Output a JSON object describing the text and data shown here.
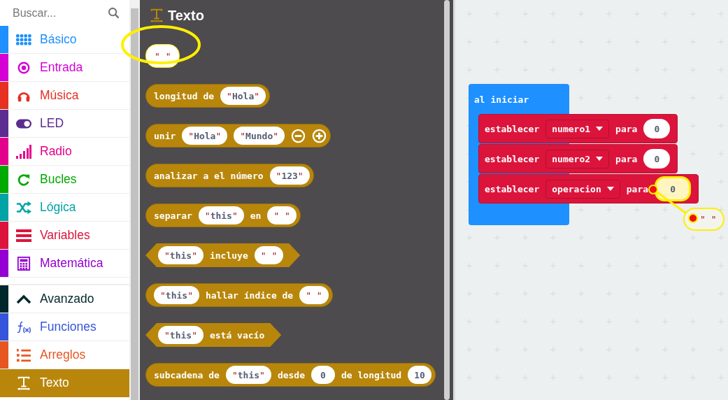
{
  "search": {
    "placeholder": "Buscar..."
  },
  "categories": [
    {
      "label": "Básico",
      "color": "#1e90ff",
      "selected": false
    },
    {
      "label": "Entrada",
      "color": "#d400d4",
      "selected": false
    },
    {
      "label": "Música",
      "color": "#e63022",
      "selected": false
    },
    {
      "label": "LED",
      "color": "#5c2d91",
      "selected": false
    },
    {
      "label": "Radio",
      "color": "#e3008c",
      "selected": false
    },
    {
      "label": "Bucles",
      "color": "#00aa00",
      "selected": false
    },
    {
      "label": "Lógica",
      "color": "#00a4a6",
      "selected": false
    },
    {
      "label": "Variables",
      "color": "#dc143c",
      "selected": false
    },
    {
      "label": "Matemática",
      "color": "#9400d3",
      "selected": false
    }
  ],
  "advanced_categories": [
    {
      "label": "Avanzado",
      "color": "#00272b",
      "selected": false
    },
    {
      "label": "Funciones",
      "color": "#3455db",
      "selected": false
    },
    {
      "label": "Arreglos",
      "color": "#e65722",
      "selected": false
    },
    {
      "label": "Texto",
      "color": "#b8860b",
      "selected": true
    }
  ],
  "flyout": {
    "title": "Texto",
    "blocks": [
      {
        "kind": "bare",
        "highlighted": true,
        "parts": [
          {
            "kind": "string",
            "value": "\" \""
          }
        ]
      },
      {
        "kind": "round",
        "highlighted": false,
        "parts": [
          {
            "kind": "label",
            "text": "longitud de"
          },
          {
            "kind": "string",
            "value": "\"Hola\""
          }
        ]
      },
      {
        "kind": "round",
        "highlighted": false,
        "parts": [
          {
            "kind": "label",
            "text": "unir"
          },
          {
            "kind": "string",
            "value": "\"Hola\""
          },
          {
            "kind": "string",
            "value": "\"Mundo\""
          },
          {
            "kind": "remove"
          },
          {
            "kind": "add"
          }
        ]
      },
      {
        "kind": "round",
        "highlighted": false,
        "parts": [
          {
            "kind": "label",
            "text": "analizar a el número"
          },
          {
            "kind": "string",
            "value": "\"123\""
          }
        ]
      },
      {
        "kind": "round",
        "highlighted": false,
        "parts": [
          {
            "kind": "label",
            "text": "separar"
          },
          {
            "kind": "string",
            "value": "\"this\""
          },
          {
            "kind": "label",
            "text": "en"
          },
          {
            "kind": "string",
            "value": "\" \""
          }
        ]
      },
      {
        "kind": "hex",
        "highlighted": false,
        "parts": [
          {
            "kind": "string",
            "value": "\"this\""
          },
          {
            "kind": "label",
            "text": "incluye"
          },
          {
            "kind": "string",
            "value": "\" \""
          }
        ]
      },
      {
        "kind": "round",
        "highlighted": false,
        "parts": [
          {
            "kind": "string",
            "value": "\"this\""
          },
          {
            "kind": "label",
            "text": "hallar índice de"
          },
          {
            "kind": "string",
            "value": "\" \""
          }
        ]
      },
      {
        "kind": "hex",
        "highlighted": false,
        "parts": [
          {
            "kind": "string",
            "value": "\"this\""
          },
          {
            "kind": "label",
            "text": "está vacío"
          }
        ]
      },
      {
        "kind": "round",
        "highlighted": false,
        "parts": [
          {
            "kind": "label",
            "text": "subcadena de"
          },
          {
            "kind": "string",
            "value": "\"this\""
          },
          {
            "kind": "label",
            "text": "desde"
          },
          {
            "kind": "number",
            "value": "0"
          },
          {
            "kind": "label",
            "text": "de longitud"
          },
          {
            "kind": "number",
            "value": "10"
          }
        ]
      }
    ]
  },
  "workspace": {
    "event": {
      "label": "al iniciar",
      "statements": [
        {
          "label": "establecer",
          "variable": "numero1",
          "connector": "para",
          "value": "0",
          "highlighted": false
        },
        {
          "label": "establecer",
          "variable": "numero2",
          "connector": "para",
          "value": "0",
          "highlighted": false
        },
        {
          "label": "establecer",
          "variable": "operacion",
          "connector": "para",
          "value": "0",
          "highlighted": true
        }
      ]
    },
    "loose_block": {
      "value": "\" \""
    }
  }
}
